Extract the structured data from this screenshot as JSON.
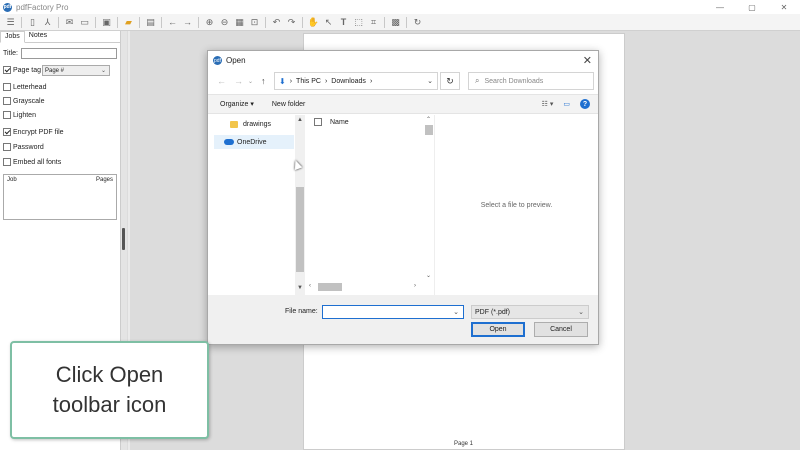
{
  "app": {
    "title": "pdfFactory Pro",
    "icon_text": "pdf"
  },
  "window_controls": {
    "minimize": "—",
    "maximize": "▢",
    "close": "✕"
  },
  "left_panel": {
    "tabs": [
      "Jobs",
      "Notes"
    ],
    "title_label": "Title:",
    "title_value": "",
    "page_tag": {
      "label": "Page tag",
      "checked": true,
      "select_value": "Page #"
    },
    "options": [
      {
        "label": "Letterhead",
        "checked": false
      },
      {
        "label": "Grayscale",
        "checked": false
      },
      {
        "label": "Lighten",
        "checked": false
      },
      {
        "label": "Encrypt PDF file",
        "checked": true
      },
      {
        "label": "Password",
        "checked": false
      },
      {
        "label": "Embed all fonts",
        "checked": false
      }
    ],
    "job_table": {
      "columns": [
        "Job",
        "Pages"
      ]
    }
  },
  "page_area": {
    "page_label": "Page 1"
  },
  "dialog": {
    "title": "Open",
    "close_glyph": "✕",
    "breadcrumb": [
      "This PC",
      "Downloads"
    ],
    "search_placeholder": "Search Downloads",
    "commands": {
      "organize": "Organize",
      "new_folder": "New folder"
    },
    "nav_items": [
      {
        "label": "drawings",
        "icon": "folder-icon",
        "selected": false
      },
      {
        "label": "OneDrive",
        "icon": "cloud-icon",
        "selected": true
      }
    ],
    "file_list": {
      "column_name": "Name"
    },
    "preview_text": "Select a file to preview.",
    "file_name_label": "File name:",
    "file_name_value": "",
    "filter_value": "PDF (*.pdf)",
    "open_button": "Open",
    "cancel_button": "Cancel"
  },
  "callout": {
    "text": "Click Open toolbar icon"
  },
  "colors": {
    "accent_blue": "#1e6fd0",
    "callout_border": "#7ebfa4",
    "folder_yellow": "#f2c54b"
  }
}
